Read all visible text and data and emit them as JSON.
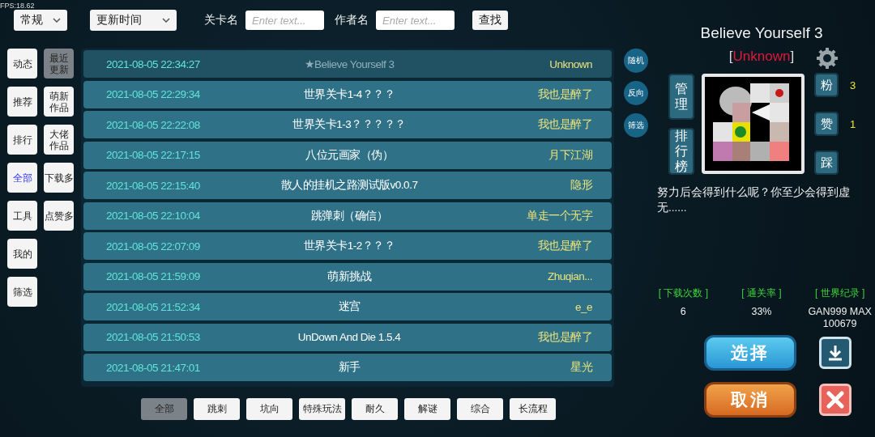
{
  "fps": "FPS:18.62",
  "filters": {
    "mode": "常规",
    "sort": "更新时间",
    "level_label": "关卡名",
    "level_placeholder": "Enter text...",
    "author_label": "作者名",
    "author_placeholder": "Enter text...",
    "search": "查找"
  },
  "sidebar": {
    "column_1": [
      {
        "label": "动态",
        "selected": false
      },
      {
        "label": "推荐",
        "selected": false
      },
      {
        "label": "排行",
        "selected": false
      },
      {
        "label": "全部",
        "selected": true
      },
      {
        "label": "工具",
        "selected": false
      },
      {
        "label": "我的",
        "selected": false
      },
      {
        "label": "筛选",
        "selected": false
      }
    ],
    "column_2": [
      {
        "label": "最近更新",
        "selected": true
      },
      {
        "label": "萌新作品",
        "selected": false
      },
      {
        "label": "大佬作品",
        "selected": false
      },
      {
        "label": "下载多",
        "selected": false
      },
      {
        "label": "点赞多",
        "selected": false
      }
    ]
  },
  "levels": [
    {
      "time": "2021-08-05 22:34:27",
      "title": "★Believe Yourself 3",
      "author": "Unknown",
      "selected": true
    },
    {
      "time": "2021-08-05 22:29:34",
      "title": "世界关卡1-4？？？",
      "author": "我也是醉了",
      "selected": false
    },
    {
      "time": "2021-08-05 22:22:08",
      "title": "世界关卡1-3？？？？？",
      "author": "我也是醉了",
      "selected": false
    },
    {
      "time": "2021-08-05 22:17:15",
      "title": "八位元画家（伪）",
      "author": "月下江湖",
      "selected": false
    },
    {
      "time": "2021-08-05 22:15:40",
      "title": "散人的挂机之路测试版v0.0.7",
      "author": "隐形",
      "selected": false
    },
    {
      "time": "2021-08-05 22:10:04",
      "title": "跳弹刺（确信）",
      "author": "单走一个无字",
      "selected": false
    },
    {
      "time": "2021-08-05 22:07:09",
      "title": "世界关卡1-2？？？",
      "author": "我也是醉了",
      "selected": false
    },
    {
      "time": "2021-08-05 21:59:09",
      "title": "萌新挑战",
      "author": "Zhuqian...",
      "selected": false
    },
    {
      "time": "2021-08-05 21:52:34",
      "title": "迷宫",
      "author": "e_e",
      "selected": false
    },
    {
      "time": "2021-08-05 21:50:53",
      "title": "UnDown And Die 1.5.4",
      "author": "我也是醉了",
      "selected": false
    },
    {
      "time": "2021-08-05 21:47:01",
      "title": "新手",
      "author": "星光",
      "selected": false
    }
  ],
  "side_actions": [
    "随机",
    "反向",
    "筛选"
  ],
  "tags": [
    {
      "label": "全部",
      "selected": true
    },
    {
      "label": "跳刺",
      "selected": false
    },
    {
      "label": "坑向",
      "selected": false
    },
    {
      "label": "特殊玩法",
      "selected": false
    },
    {
      "label": "耐久",
      "selected": false
    },
    {
      "label": "解谜",
      "selected": false
    },
    {
      "label": "综合",
      "selected": false
    },
    {
      "label": "长流程",
      "selected": false
    }
  ],
  "detail": {
    "title": "Believe Yourself 3",
    "author_open": "[",
    "author": "Unknown",
    "author_close": "]",
    "manage": "管理",
    "ranking": "排行榜",
    "fans": "粉",
    "fans_count": "3",
    "likes": "赞",
    "likes_count": "1",
    "dislike": "踩",
    "description": "努力后会得到什么呢？你至少会得到虚无......",
    "stats": [
      {
        "label": "[ 下载次数 ]",
        "value": "6"
      },
      {
        "label": "[ 通关率 ]",
        "value": "33%"
      },
      {
        "label": "[ 世界纪录 ]",
        "value": "GAN999 MAX\n100679"
      }
    ],
    "select": "选择",
    "cancel": "取消"
  }
}
